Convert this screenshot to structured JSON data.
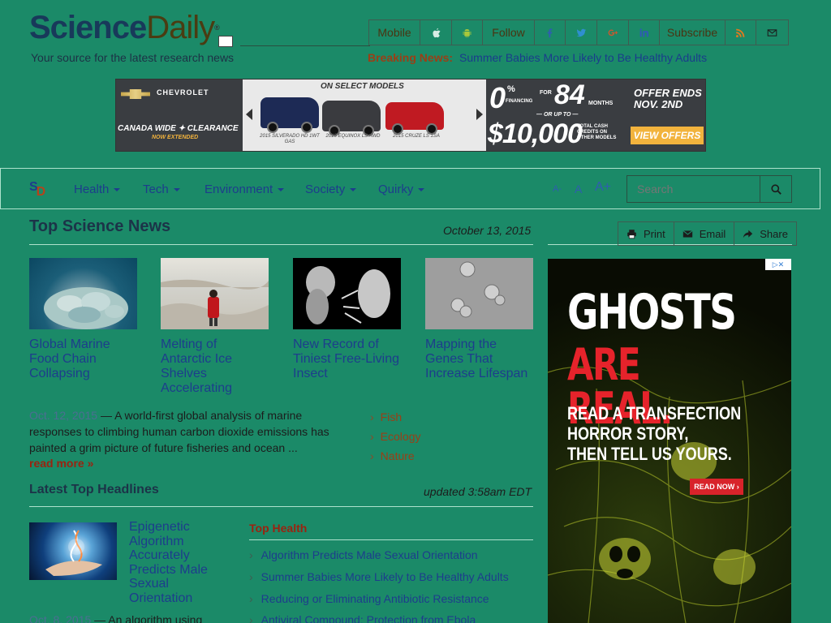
{
  "brand": {
    "name_a": "Science",
    "name_b": "Daily",
    "reg": "®",
    "tagline": "Your source for the latest research news"
  },
  "topbar": {
    "mobile": "Mobile",
    "follow": "Follow",
    "subscribe": "Subscribe"
  },
  "breaking": {
    "label": "Breaking News:",
    "headline": "Summer Babies More Likely to Be Healthy Adults"
  },
  "banner": {
    "brand": "CHEVROLET",
    "canada": "CANADA WIDE ✦ CLEARANCE",
    "extended": "NOW EXTENDED",
    "select": "ON SELECT MODELS",
    "models": [
      "2015 SILVERADO HD 1WT GAS",
      "2015 EQUINOX LS AWD",
      "2015 CRUZE LS 1SA"
    ],
    "zero": "0",
    "pct": "%",
    "financing": "FINANCING",
    "for": "FOR",
    "months_num": "84",
    "months": "MONTHS",
    "orup": "— OR UP TO —",
    "cash": "$10,000",
    "cash_note": "TOTAL CASH CREDITS ON OTHER MODELS",
    "offer": "OFFER ENDS NOV. 2ND",
    "view": "VIEW OFFERS"
  },
  "nav": {
    "logo_s": "S",
    "logo_d": "D",
    "items": [
      "Health",
      "Tech",
      "Environment",
      "Society",
      "Quirky"
    ],
    "font_small": "A-",
    "font_mid": "A",
    "font_large": "A+",
    "search_placeholder": "Search"
  },
  "top_news": {
    "title": "Top Science News",
    "date": "October 13, 2015",
    "stories": [
      {
        "title": "Global Marine Food Chain Collapsing"
      },
      {
        "title": "Melting of Antarctic Ice Shelves Accelerating"
      },
      {
        "title": "New Record of Tiniest Free-Living Insect"
      },
      {
        "title": "Mapping the Genes That Increase Lifespan"
      }
    ],
    "lead_date": "Oct. 12, 2015",
    "lead_dash": " — ",
    "lead_text": "A world-first global analysis of marine responses to climbing human carbon dioxide emissions has painted a grim picture of future fisheries and ocean ...",
    "read_more": "read more »",
    "topics": [
      "Fish",
      "Ecology",
      "Nature"
    ]
  },
  "latest": {
    "title": "Latest Top Headlines",
    "updated": "updated 3:58am EDT",
    "headline": "Epigenetic Algorithm Accurately Predicts Male Sexual Orientation",
    "foot_date": "Oct. 8, 2015",
    "foot_text": " — An algorithm using",
    "top_health_label": "Top Health",
    "top_health": [
      "Algorithm Predicts Male Sexual Orientation",
      "Summer Babies More Likely to Be Healthy Adults",
      "Reducing or Eliminating Antibiotic Resistance",
      "Antiviral Compound: Protection from Ebola"
    ]
  },
  "share": {
    "print": "Print",
    "email": "Email",
    "share": "Share"
  },
  "ad": {
    "line1": "GHOSTS",
    "line2": "ARE REAL.",
    "body": [
      "READ A TRANSFECTION",
      "HORROR STORY,",
      "THEN TELL US YOURS."
    ],
    "button": "READ NOW ›",
    "choices": "▷✕"
  },
  "colors": {
    "page_bg": "#1b8a68",
    "link": "#1d3d8c",
    "accent": "#9a2310"
  }
}
